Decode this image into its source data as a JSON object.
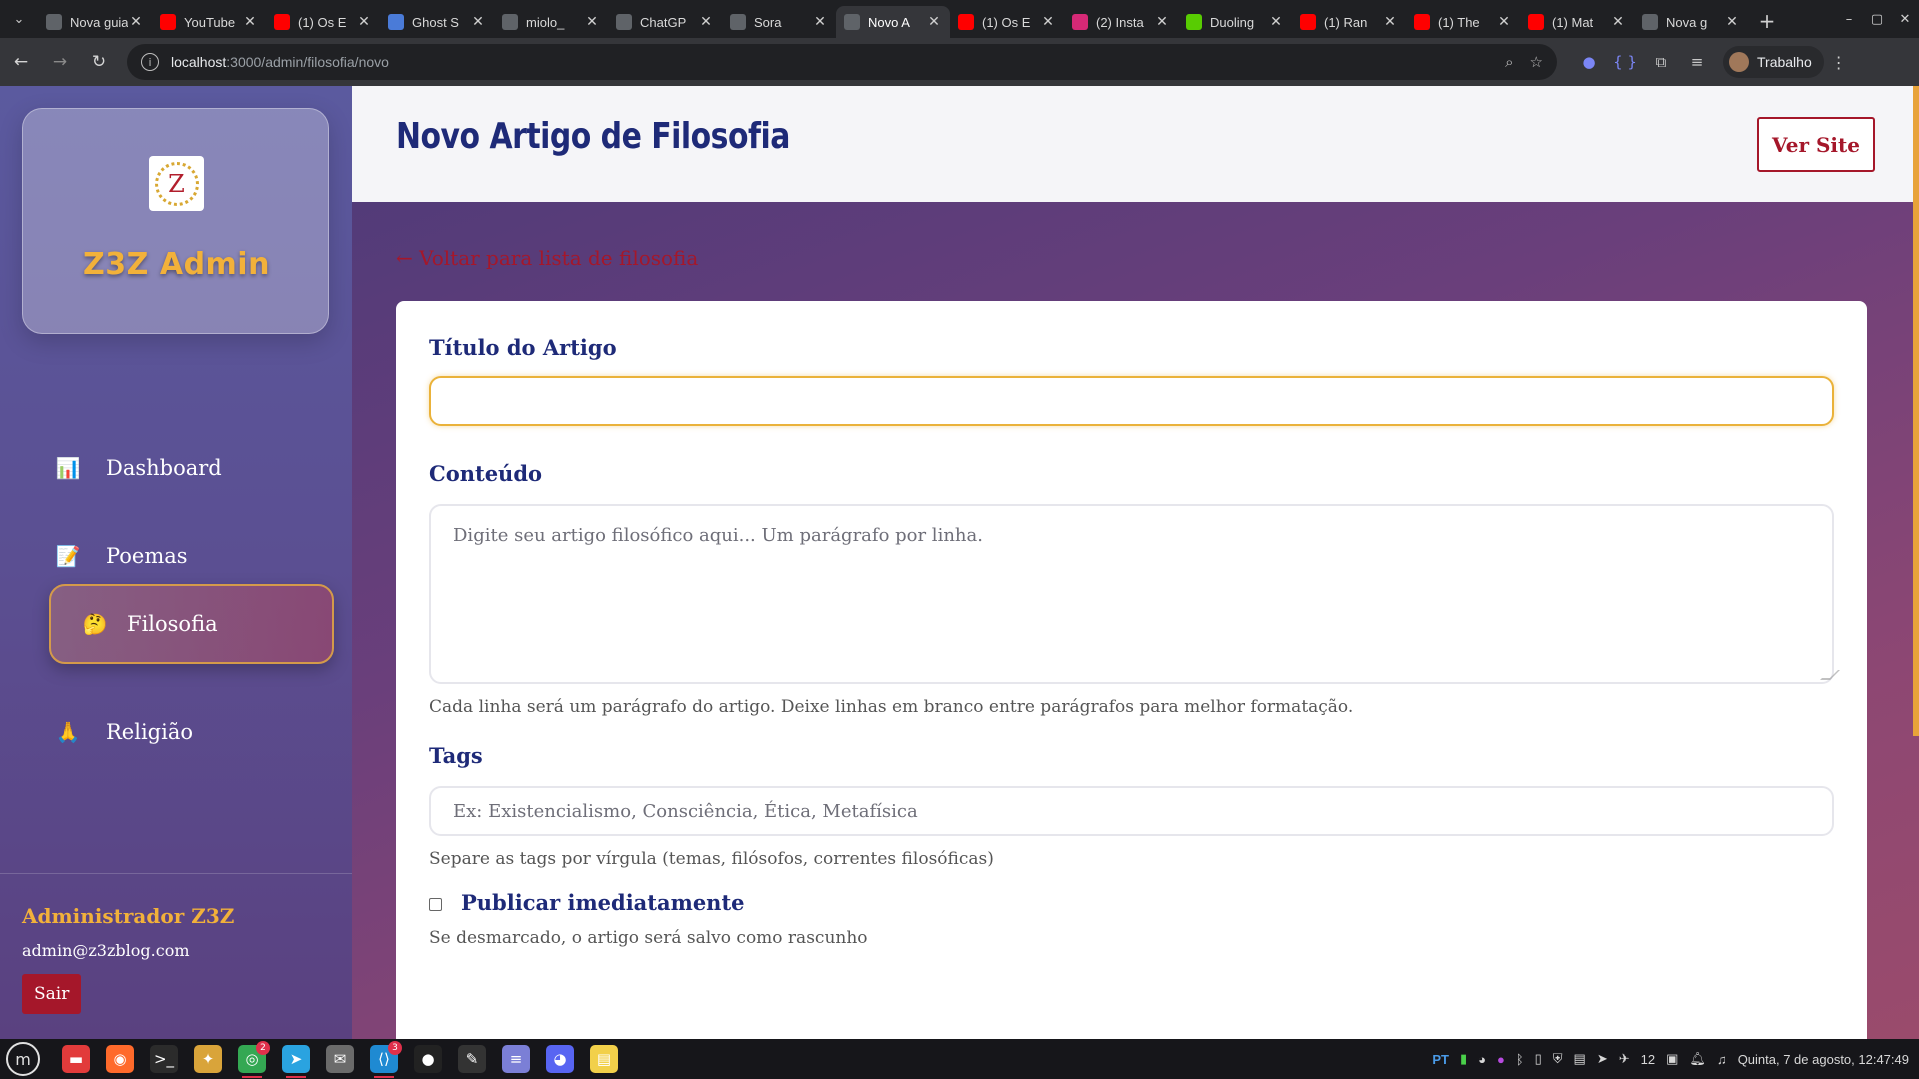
{
  "browser": {
    "tabs": [
      {
        "label": "Nova guia",
        "icon": "chrome-icon",
        "color": "#5f6368"
      },
      {
        "label": "YouTube",
        "icon": "youtube-icon",
        "color": "#ff0000"
      },
      {
        "label": "(1) Os E",
        "icon": "youtube-icon",
        "color": "#ff0000"
      },
      {
        "label": "Ghost S",
        "icon": "ghost-icon",
        "color": "#4a7bd8"
      },
      {
        "label": "miolo_",
        "icon": "globe-icon",
        "color": "#5f6368"
      },
      {
        "label": "ChatGP",
        "icon": "openai-icon",
        "color": "#5f6368"
      },
      {
        "label": "Sora",
        "icon": "sora-icon",
        "color": "#5f6368"
      },
      {
        "label": "Novo A",
        "icon": "globe-icon",
        "color": "#5f6368",
        "active": true
      },
      {
        "label": "(1) Os E",
        "icon": "youtube-icon",
        "color": "#ff0000"
      },
      {
        "label": "(2) Insta",
        "icon": "instagram-icon",
        "color": "#d62976"
      },
      {
        "label": "Duoling",
        "icon": "duolingo-icon",
        "color": "#58cc02"
      },
      {
        "label": "(1) Ran",
        "icon": "youtube-icon",
        "color": "#ff0000"
      },
      {
        "label": "(1) The",
        "icon": "youtube-icon",
        "color": "#ff0000"
      },
      {
        "label": "(1) Mat",
        "icon": "youtube-icon",
        "color": "#ff0000"
      },
      {
        "label": "Nova g",
        "icon": "chrome-icon",
        "color": "#5f6368"
      }
    ],
    "url_host": "localhost",
    "url_rest": ":3000/admin/filosofia/novo",
    "profile_name": "Trabalho"
  },
  "sidebar": {
    "brand_title": "Z3Z Admin",
    "logo_letter": "Z",
    "nav": [
      {
        "label": "Dashboard",
        "icon": "📊",
        "name": "dashboard"
      },
      {
        "label": "Poemas",
        "icon": "📝",
        "name": "poemas"
      },
      {
        "label": "Filosofia",
        "icon": "🤔",
        "name": "filosofia",
        "active": true
      },
      {
        "label": "Religião",
        "icon": "🙏",
        "name": "religiao"
      }
    ],
    "admin_name": "Administrador Z3Z",
    "admin_email": "admin@z3zblog.com",
    "logout_label": "Sair"
  },
  "header": {
    "title": "Novo Artigo de Filosofia",
    "ver_site_label": "Ver Site"
  },
  "form": {
    "back_link": "← Voltar para lista de filosofia",
    "title_label": "Título do Artigo",
    "title_value": "",
    "content_label": "Conteúdo",
    "content_placeholder": "Digite seu artigo filosófico aqui... Um parágrafo por linha.",
    "content_help": "Cada linha será um parágrafo do artigo. Deixe linhas em branco entre parágrafos para melhor formatação.",
    "tags_label": "Tags",
    "tags_placeholder": "Ex: Existencialismo, Consciência, Ética, Metafísica",
    "tags_help": "Separe as tags por vírgula (temas, filósofos, correntes filosóficas)",
    "publish_label": "Publicar imediatamente",
    "publish_checked": false,
    "publish_help": "Se desmarcado, o artigo será salvo como rascunho"
  },
  "taskbar": {
    "apps": [
      {
        "name": "files-app",
        "color": "#e23b3b",
        "glyph": "▬"
      },
      {
        "name": "firefox-app",
        "color": "#ff6a2b",
        "glyph": "◉"
      },
      {
        "name": "terminal-app",
        "color": "#2b2b2b",
        "glyph": ">_"
      },
      {
        "name": "pidgin-app",
        "color": "#d9a43a",
        "glyph": "✦"
      },
      {
        "name": "chrome-app",
        "color": "#34a853",
        "glyph": "◎",
        "badge": "2",
        "running": true
      },
      {
        "name": "telegram-app",
        "color": "#2aa3e0",
        "glyph": "➤",
        "running": true
      },
      {
        "name": "mail-app",
        "color": "#6b6b6b",
        "glyph": "✉"
      },
      {
        "name": "vscode-app",
        "color": "#1f8ad2",
        "glyph": "⟨⟩",
        "badge": "3",
        "running": true
      },
      {
        "name": "obs-app",
        "color": "#222",
        "glyph": "●"
      },
      {
        "name": "inkscape-app",
        "color": "#333",
        "glyph": "✎"
      },
      {
        "name": "notes-app",
        "color": "#7b7fd6",
        "glyph": "≡"
      },
      {
        "name": "discord-app",
        "color": "#5865f2",
        "glyph": "◕"
      },
      {
        "name": "sticky-app",
        "color": "#f2d04a",
        "glyph": "▤"
      }
    ],
    "tray_lang": "PT",
    "tray_volume": "12",
    "clock": "Quinta, 7 de agosto, 12:47:49"
  },
  "colors": {
    "accent_gold": "#f2b13a",
    "accent_red": "#a5172a",
    "title_blue": "#1e2a78"
  }
}
